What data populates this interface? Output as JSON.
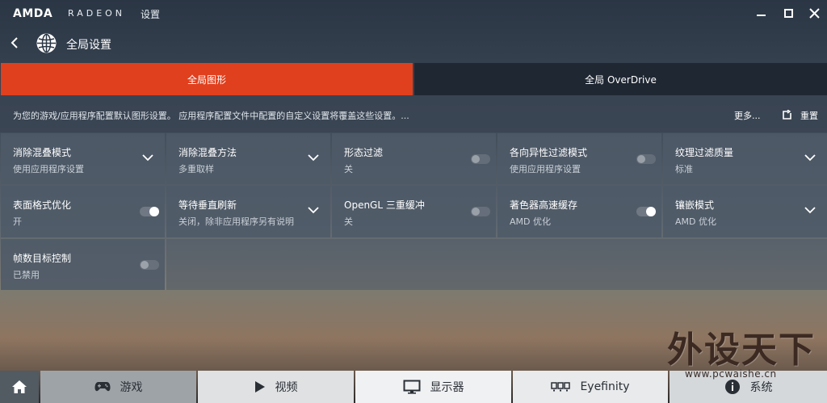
{
  "titlebar": {
    "brand": "AMDA",
    "product": "RADEON",
    "settings": "设置"
  },
  "header": {
    "title": "全局设置"
  },
  "tabs": [
    {
      "label": "全局图形",
      "active": true
    },
    {
      "label": "全局 OverDrive",
      "active": false
    }
  ],
  "description": {
    "text": "为您的游戏/应用程序配置默认图形设置。 应用程序配置文件中配置的自定义设置将覆盖这些设置。...",
    "more": "更多...",
    "reset": "重置"
  },
  "settings": [
    {
      "label": "消除混叠模式",
      "value": "使用应用程序设置",
      "control": "dropdown"
    },
    {
      "label": "消除混叠方法",
      "value": "多重取样",
      "control": "dropdown"
    },
    {
      "label": "形态过滤",
      "value": "关",
      "control": "toggle",
      "on": false
    },
    {
      "label": "各向异性过滤模式",
      "value": "使用应用程序设置",
      "control": "toggle",
      "on": false
    },
    {
      "label": "纹理过滤质量",
      "value": "标准",
      "control": "dropdown"
    },
    {
      "label": "表面格式优化",
      "value": "开",
      "control": "toggle",
      "on": true
    },
    {
      "label": "等待垂直刷新",
      "value": "关闭，除非应用程序另有说明",
      "control": "dropdown"
    },
    {
      "label": "OpenGL 三重缓冲",
      "value": "关",
      "control": "toggle",
      "on": false
    },
    {
      "label": "著色器高速缓存",
      "value": "AMD 优化",
      "control": "toggle",
      "on": true
    },
    {
      "label": "镶嵌模式",
      "value": "AMD 优化",
      "control": "dropdown"
    },
    {
      "label": "帧数目标控制",
      "value": "已禁用",
      "control": "toggle",
      "on": false
    }
  ],
  "watermark": {
    "text": "外设天下",
    "url": "www.pcwaishe.cn"
  },
  "bottom_nav": {
    "home_icon": "home-icon",
    "games": "游戏",
    "video": "视频",
    "display": "显示器",
    "eyefinity": "Eyefinity",
    "system": "系统"
  },
  "colors": {
    "accent": "#e0401e",
    "tab_inactive": "#1f2733",
    "cell_bg": "#4e5a68"
  }
}
